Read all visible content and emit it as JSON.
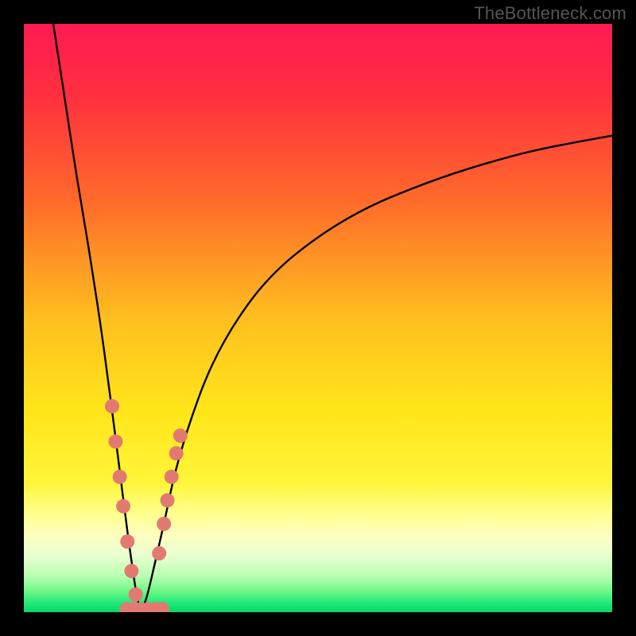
{
  "watermark": "TheBottleneck.com",
  "colors": {
    "frame": "#000000",
    "gradient_stops": [
      {
        "offset": 0.0,
        "color": "#ff1a52"
      },
      {
        "offset": 0.12,
        "color": "#ff2f3f"
      },
      {
        "offset": 0.3,
        "color": "#ff6a2a"
      },
      {
        "offset": 0.5,
        "color": "#ffbf1f"
      },
      {
        "offset": 0.66,
        "color": "#ffe61a"
      },
      {
        "offset": 0.78,
        "color": "#fff53a"
      },
      {
        "offset": 0.83,
        "color": "#ffff8a"
      },
      {
        "offset": 0.87,
        "color": "#fdffc0"
      },
      {
        "offset": 0.905,
        "color": "#e8ffd0"
      },
      {
        "offset": 0.94,
        "color": "#b6ffb0"
      },
      {
        "offset": 0.965,
        "color": "#6cf884"
      },
      {
        "offset": 0.985,
        "color": "#20e878"
      },
      {
        "offset": 1.0,
        "color": "#06d866"
      }
    ],
    "curve": "#000000",
    "marker": "#e27a72"
  },
  "chart_data": {
    "type": "line",
    "title": "",
    "xlabel": "",
    "ylabel": "",
    "xlim": [
      0,
      100
    ],
    "ylim": [
      0,
      100
    ],
    "grid": false,
    "legend": false,
    "annotation_note": "two-branch V-shaped bottleneck curve with minimum near x≈20; y is percent away from optimum (0 at bottom).",
    "series": [
      {
        "name": "left_branch",
        "x": [
          5,
          7,
          9,
          11,
          13,
          14.5,
          15.8,
          16.8,
          17.7,
          18.4,
          19.0,
          19.5,
          20.0
        ],
        "y": [
          100,
          87,
          74,
          62,
          49,
          38,
          28,
          20,
          13,
          8,
          4,
          1.5,
          0
        ]
      },
      {
        "name": "right_branch",
        "x": [
          20.0,
          21.0,
          22.2,
          23.8,
          25.8,
          28.5,
          32.0,
          36.5,
          42.0,
          49.0,
          57.0,
          66.0,
          76.0,
          87.0,
          100.0
        ],
        "y": [
          0,
          3,
          8,
          15,
          24,
          33,
          42,
          50,
          57,
          63,
          68,
          72,
          75.5,
          78.5,
          81
        ]
      }
    ],
    "markers": {
      "note": "salmon-colored sample dots clustered around the minimum on both branches and along the base",
      "points": [
        {
          "x": 15.0,
          "y": 35
        },
        {
          "x": 15.6,
          "y": 29
        },
        {
          "x": 16.3,
          "y": 23
        },
        {
          "x": 16.9,
          "y": 18
        },
        {
          "x": 17.6,
          "y": 12
        },
        {
          "x": 18.3,
          "y": 7
        },
        {
          "x": 19.0,
          "y": 3
        },
        {
          "x": 23.0,
          "y": 10
        },
        {
          "x": 23.8,
          "y": 15
        },
        {
          "x": 24.4,
          "y": 19
        },
        {
          "x": 25.1,
          "y": 23
        },
        {
          "x": 25.9,
          "y": 27
        },
        {
          "x": 26.6,
          "y": 30
        },
        {
          "x": 17.5,
          "y": 0.5
        },
        {
          "x": 18.7,
          "y": 0.5
        },
        {
          "x": 19.9,
          "y": 0.5
        },
        {
          "x": 21.1,
          "y": 0.5
        },
        {
          "x": 22.3,
          "y": 0.5
        },
        {
          "x": 23.5,
          "y": 0.5
        }
      ],
      "radius_px": 9
    }
  }
}
